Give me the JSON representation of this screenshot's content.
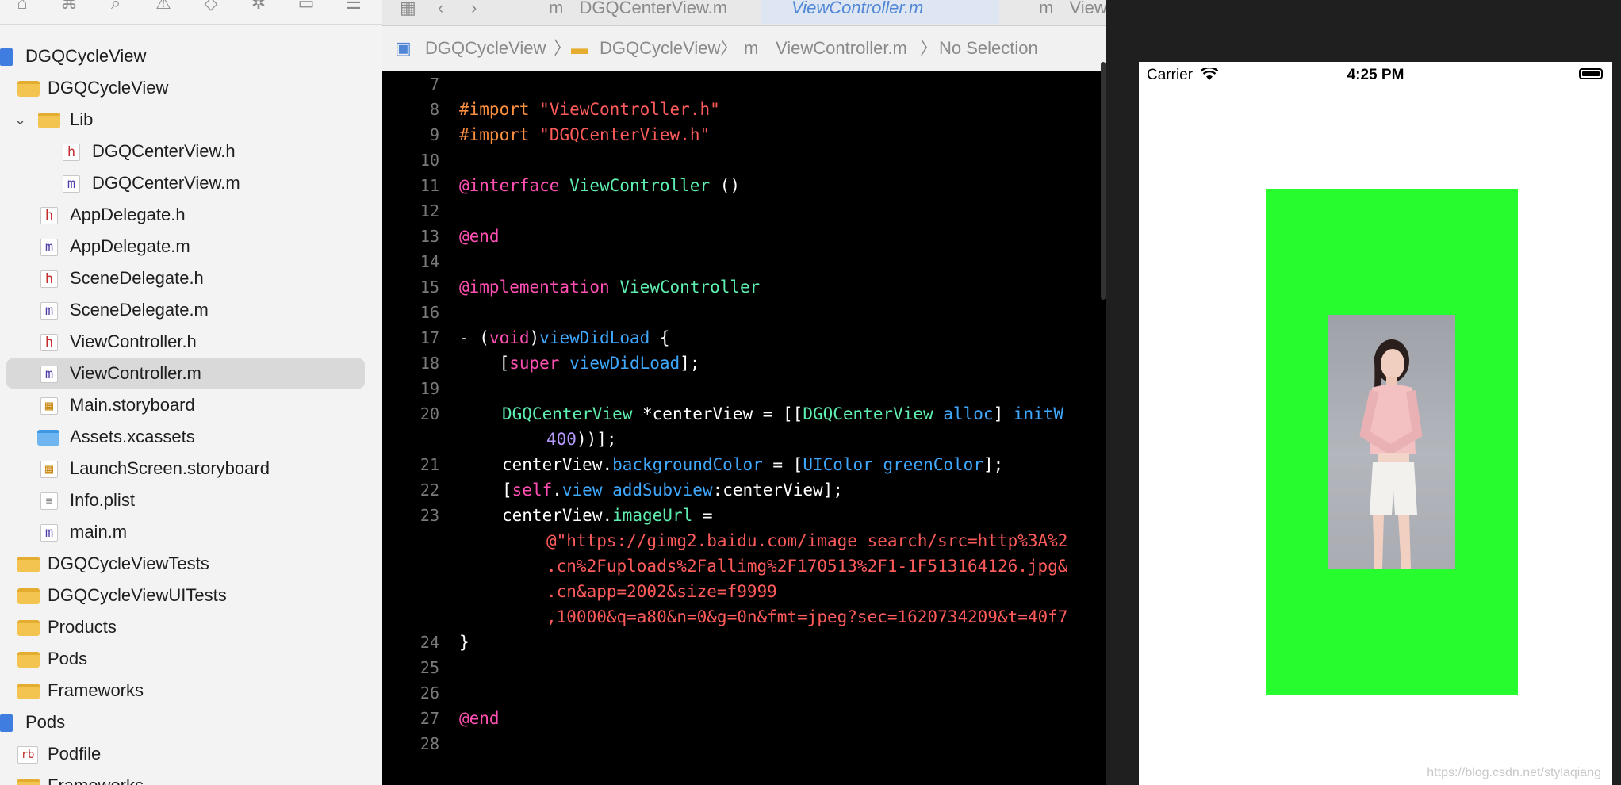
{
  "colors": {
    "center_view_bg": "#27fc2e",
    "selection_bg": "#d9d9d9",
    "keyword": "#ff4fb3",
    "string": "#ff5b5b"
  },
  "navigator": {
    "toolbar_icons": [
      "folder-icon",
      "hierarchy-icon",
      "search-icon",
      "warning-icon",
      "test-icon",
      "debug-icon",
      "breakpoint-icon",
      "report-icon"
    ],
    "items": [
      {
        "label": "DGQCycleView",
        "icon": "project-icon"
      },
      {
        "label": "DGQCycleView",
        "icon": "folder-icon"
      },
      {
        "label": "Lib",
        "icon": "folder-icon"
      },
      {
        "label": "DGQCenterView.h",
        "icon": "h-file-icon"
      },
      {
        "label": "DGQCenterView.m",
        "icon": "m-file-icon"
      },
      {
        "label": "AppDelegate.h",
        "icon": "h-file-icon"
      },
      {
        "label": "AppDelegate.m",
        "icon": "m-file-icon"
      },
      {
        "label": "SceneDelegate.h",
        "icon": "h-file-icon"
      },
      {
        "label": "SceneDelegate.m",
        "icon": "m-file-icon"
      },
      {
        "label": "ViewController.h",
        "icon": "h-file-icon"
      },
      {
        "label": "ViewController.m",
        "icon": "m-file-icon",
        "selected": true
      },
      {
        "label": "Main.storyboard",
        "icon": "storyboard-icon"
      },
      {
        "label": "Assets.xcassets",
        "icon": "assets-folder-icon"
      },
      {
        "label": "LaunchScreen.storyboard",
        "icon": "storyboard-icon"
      },
      {
        "label": "Info.plist",
        "icon": "plist-icon"
      },
      {
        "label": "main.m",
        "icon": "m-file-icon"
      },
      {
        "label": "DGQCycleViewTests",
        "icon": "folder-icon"
      },
      {
        "label": "DGQCycleViewUITests",
        "icon": "folder-icon"
      },
      {
        "label": "Products",
        "icon": "folder-icon"
      },
      {
        "label": "Pods",
        "icon": "folder-icon"
      },
      {
        "label": "Frameworks",
        "icon": "folder-icon"
      },
      {
        "label": "Pods",
        "icon": "project-icon"
      },
      {
        "label": "Podfile",
        "icon": "ruby-file-icon"
      },
      {
        "label": "Frameworks",
        "icon": "folder-icon"
      }
    ]
  },
  "editor": {
    "tabs": [
      "DGQCenterView.m",
      "ViewController.m",
      "View"
    ],
    "file_icon_letter": "m",
    "jumpbar": [
      "DGQCycleView",
      "DGQCycleView",
      "ViewController.m",
      "No Selection"
    ],
    "line_numbers": [
      "7",
      "8",
      "9",
      "10",
      "11",
      "12",
      "13",
      "14",
      "15",
      "16",
      "17",
      "18",
      "19",
      "20",
      "",
      "21",
      "22",
      "23",
      "",
      "",
      "",
      "",
      "24",
      "25",
      "26",
      "27",
      "28"
    ],
    "tokens": {
      "import": "#import",
      "vc_h": "\"ViewController.h\"",
      "cv_h": "\"DGQCenterView.h\"",
      "interface": "@interface",
      "vc": "ViewController",
      "parens": " ()",
      "end": "@end",
      "implementation": "@implementation",
      "dash": "- (",
      "void": "void",
      "close_paren": ")",
      "viewDidLoad": "viewDidLoad",
      "open_brace": " {",
      "super_open": "    [",
      "super": "super",
      "call_end": "];",
      "cv_class": "DGQCenterView",
      "decl": " *centerView = [[",
      "alloc": "alloc",
      "initW": "initW",
      "num400": "400",
      "line20b_end": "))];",
      "centerView": "centerView",
      "dot": ".",
      "backgroundColor": "backgroundColor",
      "eq_bracket": " = [",
      "UIColor": "UIColor",
      "greenColor": "greenColor",
      "self": "self",
      "view": "view",
      "addSubview": "addSubview",
      "colon_cv": ":centerView];",
      "imageUrl": "imageUrl",
      "eq": " =",
      "url1": "@\"https://gimg2.baidu.com/image_search/src=http%3A%2",
      "url2": ".cn%2Fuploads%2Fallimg%2F170513%2F1-1F513164126.jpg&",
      "url3": ".cn&app=2002&size=f9999",
      "url4": ",10000&q=a80&n=0&g=0n&fmt=jpeg?sec=1620734209&t=40f7",
      "close_brace": "}"
    }
  },
  "simulator": {
    "carrier": "Carrier",
    "time": "4:25 PM"
  },
  "watermark": "https://blog.csdn.net/stylaqiang"
}
